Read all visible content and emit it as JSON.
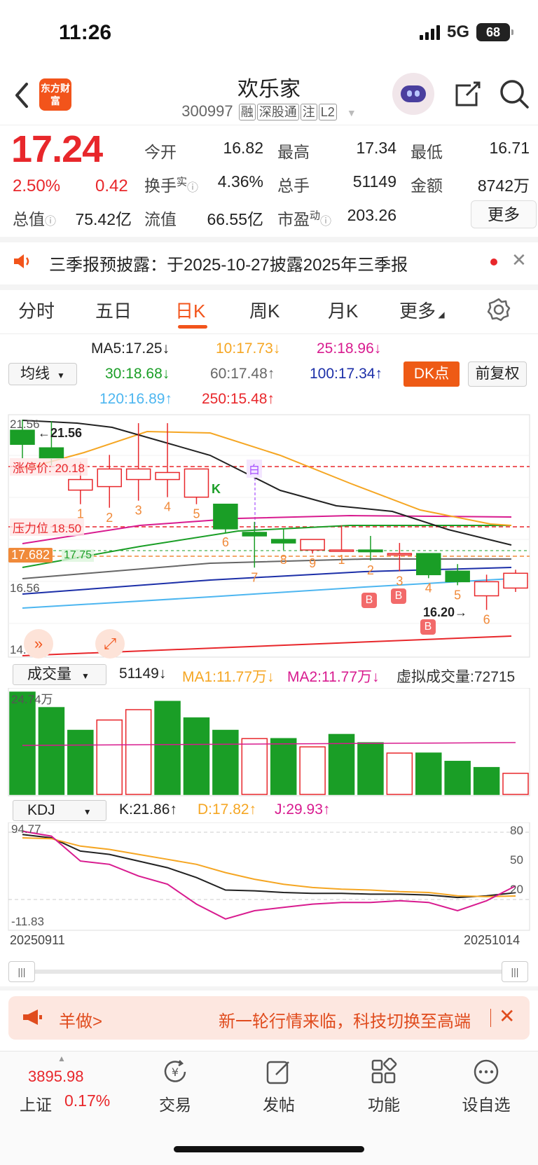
{
  "status_bar": {
    "time": "11:26",
    "network": "5G",
    "battery": "68"
  },
  "header": {
    "logo_text": "东方财富",
    "stock_name": "欢乐家",
    "stock_code": "300997",
    "tags": [
      "融",
      "深股通",
      "注",
      "L2"
    ]
  },
  "quote": {
    "price": "17.24",
    "change_pct": "2.50%",
    "change": "0.42",
    "rows": [
      [
        [
          "今开",
          "16.82",
          "normal"
        ],
        [
          "最高",
          "17.34",
          "red"
        ],
        [
          "最低",
          "16.71",
          "green"
        ]
      ],
      [
        [
          "换手",
          "4.36%",
          "normal"
        ],
        [
          "总手",
          "51149",
          "normal"
        ],
        [
          "金额",
          "8742万",
          "normal"
        ]
      ],
      [
        [
          "总值",
          "75.42亿",
          "normal"
        ],
        [
          "流值",
          "66.55亿",
          "normal"
        ],
        [
          "市盈",
          "203.26",
          "normal"
        ]
      ]
    ],
    "turnover_sup": "实",
    "pe_sup": "动",
    "more_label": "更多"
  },
  "notice": {
    "text": "三季报预披露：于2025-10-27披露2025年三季报"
  },
  "tabs": [
    "分时",
    "五日",
    "日K",
    "周K",
    "月K",
    "更多"
  ],
  "active_tab": "日K",
  "indicators": {
    "ma_select": "均线",
    "ma5": "MA5:17.25↓",
    "ma10": "10:17.73↓",
    "ma25": "25:18.96↓",
    "ma30": "30:18.68↓",
    "ma60": "60:17.48↑",
    "ma100": "100:17.34↑",
    "ma120": "120:16.89↑",
    "ma250": "250:15.48↑",
    "dk_label": "DK点",
    "fq_label": "前复权"
  },
  "chart_data": [
    {
      "type": "candlestick",
      "title": "日K",
      "y_axis_labels": [
        "21.56",
        "16.56",
        "14.90"
      ],
      "price_tags": {
        "limit_up": "涨停价: 20.18",
        "resistance": "压力位 18.50",
        "current": "17.682",
        "ma_tag": "17.75"
      },
      "annotations": {
        "high": "←21.56",
        "low": "16.20→",
        "marker_white": "白",
        "marker_k": "K"
      },
      "candles": [
        {
          "o": 21.3,
          "c": 20.9,
          "h": 21.6,
          "l": 20.5
        },
        {
          "o": 20.8,
          "c": 20.5,
          "h": 21.56,
          "l": 20.3
        },
        {
          "o": 19.6,
          "c": 19.9,
          "h": 20.4,
          "l": 19.2
        },
        {
          "o": 19.7,
          "c": 20.2,
          "h": 20.6,
          "l": 19.1
        },
        {
          "o": 19.9,
          "c": 20.2,
          "h": 21.5,
          "l": 19.3
        },
        {
          "o": 19.9,
          "c": 20.1,
          "h": 21.5,
          "l": 19.4
        },
        {
          "o": 19.4,
          "c": 20.2,
          "h": 20.2,
          "l": 19.2
        },
        {
          "o": 19.2,
          "c": 18.5,
          "h": 19.2,
          "l": 18.4
        },
        {
          "o": 18.4,
          "c": 18.3,
          "h": 18.7,
          "l": 17.4
        },
        {
          "o": 18.2,
          "c": 18.1,
          "h": 18.5,
          "l": 17.9
        },
        {
          "o": 17.9,
          "c": 18.2,
          "h": 18.2,
          "l": 17.8
        },
        {
          "o": 17.9,
          "c": 17.9,
          "h": 18.6,
          "l": 17.9
        },
        {
          "o": 17.9,
          "c": 17.85,
          "h": 18.3,
          "l": 17.6
        },
        {
          "o": 17.8,
          "c": 17.8,
          "h": 18.1,
          "l": 17.3
        },
        {
          "o": 17.8,
          "c": 17.2,
          "h": 17.8,
          "l": 17.1
        },
        {
          "o": 17.3,
          "c": 17.0,
          "h": 17.5,
          "l": 16.9
        },
        {
          "o": 16.6,
          "c": 17.0,
          "h": 17.2,
          "l": 16.2
        },
        {
          "o": 16.82,
          "c": 17.24,
          "h": 17.34,
          "l": 16.71
        }
      ],
      "candle_labels": [
        "",
        "",
        "1",
        "2",
        "3",
        "4",
        "5",
        "6",
        "7",
        "8",
        "9",
        "1",
        "2",
        "3",
        "4",
        "5",
        "6",
        ""
      ],
      "buy_markers": [
        "B",
        "B",
        "B"
      ]
    },
    {
      "type": "bar",
      "title": "成交量",
      "y_axis_labels": [
        "24.74万"
      ],
      "header": {
        "select": "成交量",
        "vol": "51149↓",
        "ma1": "MA1:11.77万↓",
        "ma2": "MA2:11.77万↓",
        "virtual": "虚拟成交量:72715"
      },
      "values": [
        24.74,
        21.0,
        15.5,
        18.0,
        20.5,
        22.5,
        18.5,
        15.5,
        13.5,
        13.5,
        11.5,
        14.5,
        12.5,
        10.0,
        10.0,
        8.0,
        6.5,
        5.1
      ],
      "up": [
        false,
        false,
        false,
        true,
        true,
        false,
        false,
        false,
        true,
        false,
        true,
        false,
        false,
        true,
        false,
        false,
        false,
        true
      ]
    },
    {
      "type": "line",
      "title": "KDJ",
      "header": {
        "select": "KDJ",
        "k": "K:21.86↑",
        "d": "D:17.82↑",
        "j": "J:29.93↑"
      },
      "y_axis_labels": [
        "94.77",
        "-11.83"
      ],
      "right_labels": [
        "80",
        "50",
        "20"
      ],
      "x_labels": [
        "20250911",
        "20251014"
      ],
      "series": [
        {
          "name": "K",
          "values": [
            92,
            88,
            72,
            68,
            60,
            52,
            40,
            25,
            24,
            22,
            21,
            21,
            20,
            20,
            19,
            16,
            18,
            21.86
          ]
        },
        {
          "name": "D",
          "values": [
            88,
            87,
            78,
            74,
            68,
            62,
            56,
            46,
            38,
            32,
            28,
            26,
            25,
            23,
            22,
            18,
            17,
            17.82
          ]
        },
        {
          "name": "J",
          "values": [
            96,
            90,
            60,
            56,
            42,
            32,
            8,
            -10,
            0,
            4,
            8,
            10,
            10,
            12,
            10,
            0,
            12,
            29.93
          ]
        }
      ]
    }
  ],
  "banner": {
    "left": "羊做>",
    "right": "新一轮行情来临，科技切换至高端"
  },
  "bottom_nav": {
    "index_value": "3895.98",
    "index_name": "上证",
    "index_pct": "0.17%",
    "items": [
      "交易",
      "发帖",
      "功能",
      "设自选"
    ]
  }
}
